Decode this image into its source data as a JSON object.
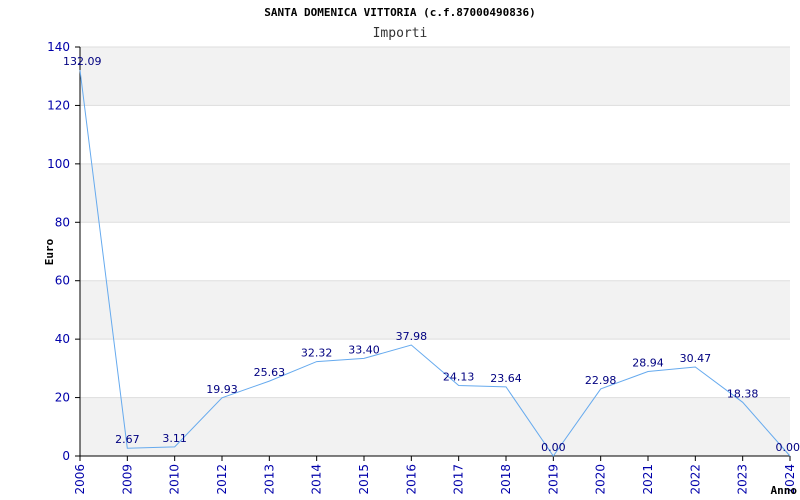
{
  "chart_data": {
    "type": "line",
    "title": "SANTA DOMENICA VITTORIA (c.f.87000490836)",
    "subtitle": "Importi",
    "xlabel": "Anno",
    "ylabel": "Euro",
    "ylim": [
      0,
      140
    ],
    "yticks": [
      0,
      20,
      40,
      60,
      80,
      100,
      120,
      140
    ],
    "categories": [
      "2006",
      "2009",
      "2010",
      "2012",
      "2013",
      "2014",
      "2015",
      "2016",
      "2017",
      "2018",
      "2019",
      "2020",
      "2021",
      "2022",
      "2023",
      "2024"
    ],
    "values": [
      132.09,
      2.67,
      3.11,
      19.93,
      25.63,
      32.32,
      33.4,
      37.98,
      24.13,
      23.64,
      0.0,
      22.98,
      28.94,
      30.47,
      18.38,
      0.0
    ],
    "value_labels": [
      "132.09",
      "2.67",
      "3.11",
      "19.93",
      "25.63",
      "32.32",
      "33.40",
      "37.98",
      "24.13",
      "23.64",
      "0.00",
      "22.98",
      "28.94",
      "30.47",
      "18.38",
      "0.00"
    ],
    "grid": true,
    "colors": {
      "line": "#66aaee",
      "band": "#f2f2f2",
      "grid": "#dddddd",
      "axis": "#000000",
      "tick_text": "#0000aa",
      "data_label": "#000080"
    }
  }
}
